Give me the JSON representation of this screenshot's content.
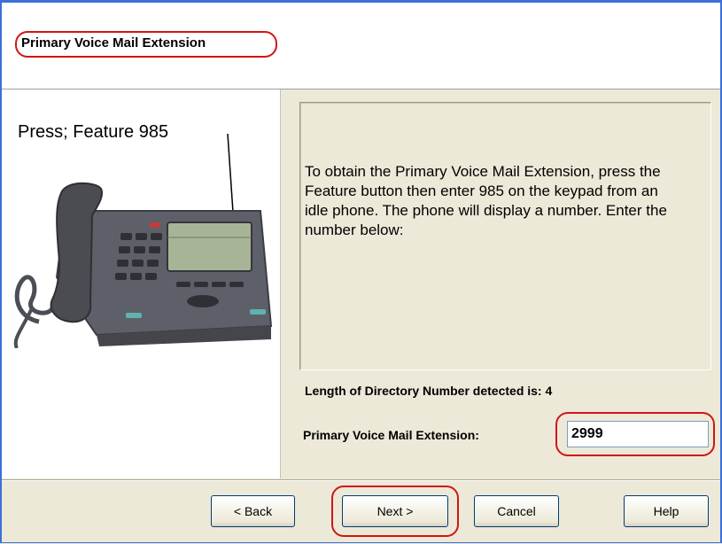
{
  "header": {
    "title": "Primary Voice Mail Extension"
  },
  "instruction_image": {
    "caption": "Press; Feature 985"
  },
  "description": {
    "text": "To obtain the Primary Voice Mail Extension, press the Feature button then enter 985 on the keypad from an idle phone. The phone will display a number. Enter the number below:"
  },
  "form": {
    "detected_length": "Length of Directory Number detected is: 4",
    "extension_label": "Primary Voice Mail Extension:",
    "extension_value": "2999"
  },
  "buttons": {
    "back": "< Back",
    "next": "Next >",
    "cancel": "Cancel",
    "help": "Help"
  },
  "colors": {
    "highlight_ring": "#d11515",
    "window_border": "#3d6fd8"
  }
}
